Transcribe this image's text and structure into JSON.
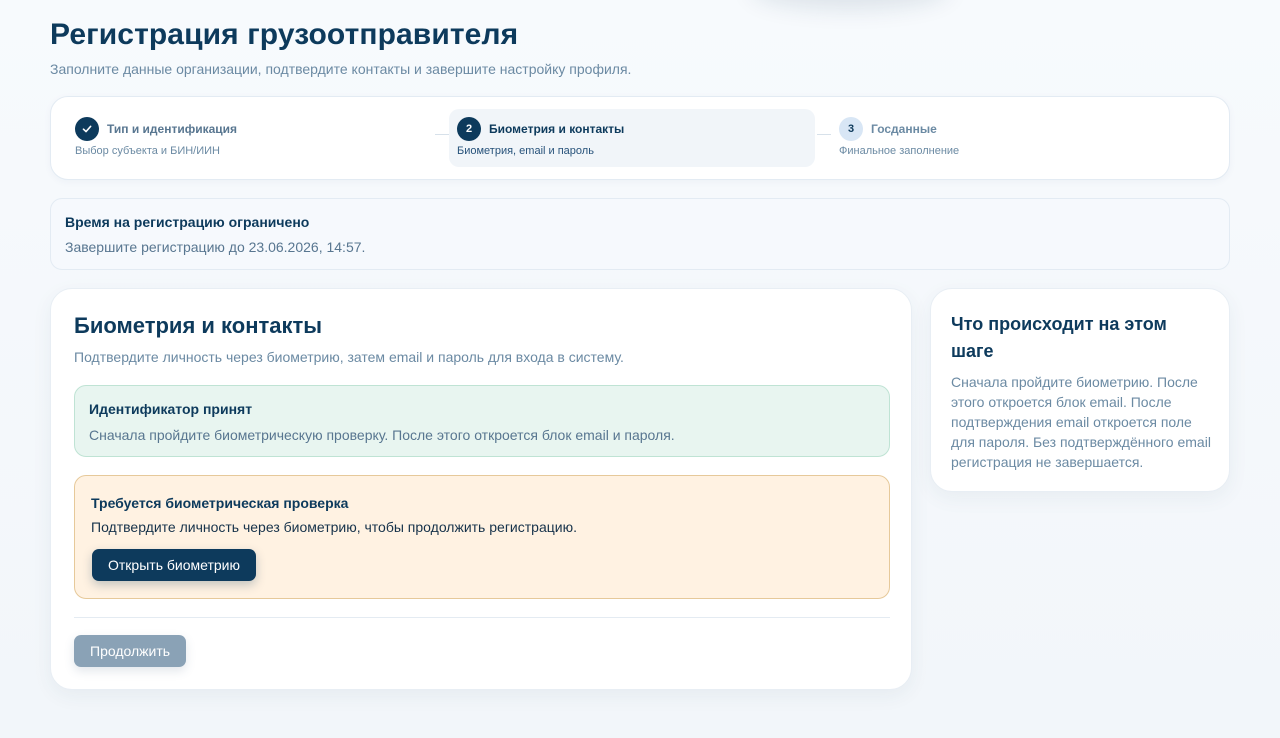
{
  "page": {
    "title": "Регистрация грузоотправителя",
    "subtitle": "Заполните данные организации, подтвердите контакты и завершите настройку профиля."
  },
  "stepper": {
    "steps": [
      {
        "number": "✓",
        "title": "Тип и идентификация",
        "description": "Выбор субъекта и БИН/ИИН",
        "state": "completed"
      },
      {
        "number": "2",
        "title": "Биометрия и контакты",
        "description": "Биометрия, email и пароль",
        "state": "active"
      },
      {
        "number": "3",
        "title": "Госданные",
        "description": "Финальное заполнение",
        "state": "upcoming"
      }
    ]
  },
  "timer": {
    "title": "Время на регистрацию ограничено",
    "text": "Завершите регистрацию до 23.06.2026, 14:57."
  },
  "main": {
    "title": "Биометрия и контакты",
    "subtitle": "Подтвердите личность через биометрию, затем email и пароль для входа в систему.",
    "success_alert": {
      "title": "Идентификатор принят",
      "text": "Сначала пройдите биометрическую проверку. После этого откроется блок email и пароля."
    },
    "warning_alert": {
      "title": "Требуется биометрическая проверка",
      "text": "Подтвердите личность через биометрию, чтобы продолжить регистрацию.",
      "button_label": "Открыть биометрию"
    },
    "continue_label": "Продолжить",
    "continue_disabled": true
  },
  "sidebar": {
    "title": "Что происходит на этом шаге",
    "text": "Сначала пройдите биометрию. После этого откроется блок email. После подтверждения email откроется поле для пароля. Без подтверждённого email регистрация не завершается."
  },
  "colors": {
    "primary": "#0d3a5c",
    "success_bg": "#e8f5f0",
    "warning_bg": "#fff2e2",
    "disabled_button": "#8aa2b6"
  },
  "icons": {
    "completed_step": "check-icon"
  }
}
